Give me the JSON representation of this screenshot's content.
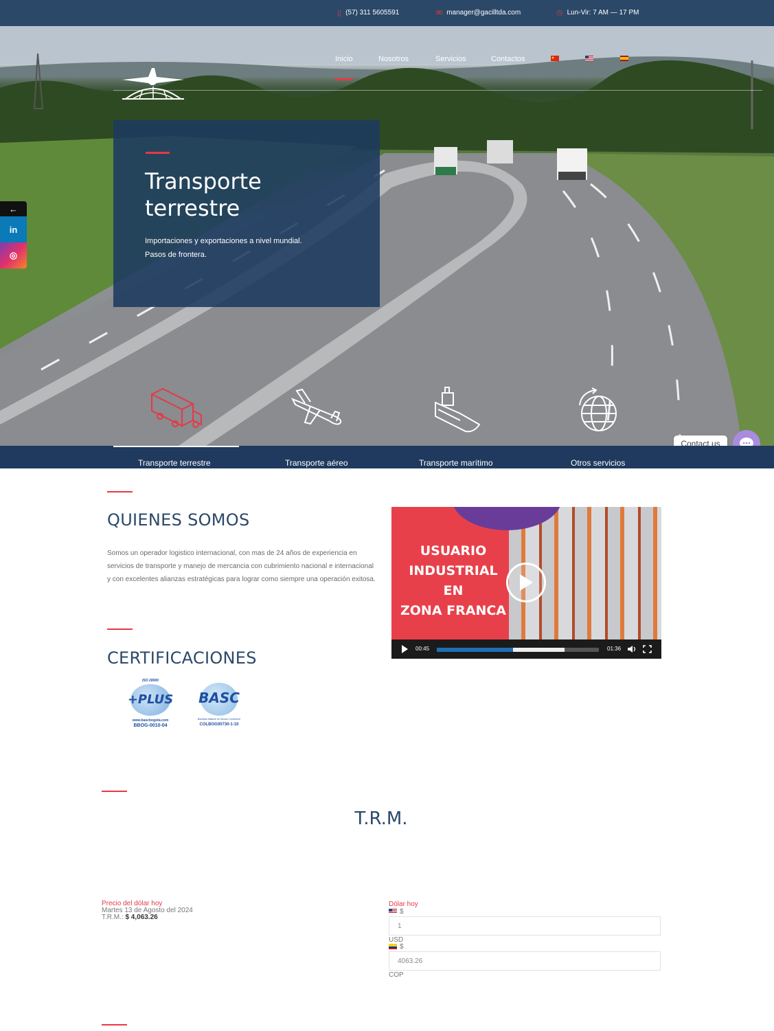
{
  "topbar": {
    "phone": "(57) 311 5605591",
    "email": "manager@gacilltda.com",
    "hours": "Lun-Vir: 7 AM — 17 PM",
    "icons": [
      "phone-icon",
      "mail-icon",
      "clock-icon"
    ]
  },
  "nav": {
    "items": [
      "Inicio",
      "Nosotros",
      "Servicios",
      "Contactos"
    ],
    "active": "Inicio",
    "languages": [
      "chinese-flag",
      "us-flag",
      "spanish-flag"
    ]
  },
  "hero": {
    "title": "Transporte terrestre",
    "line1": "Importaciones y exportaciones a nivel mundial.",
    "line2": "Pasos de frontera."
  },
  "services": {
    "tabs": [
      "Transporte terrestre",
      "Transporte aéreo",
      "Transporte marítimo",
      "Otros servicios"
    ],
    "icons": [
      "truck-icon",
      "airplane-icon",
      "ship-icon",
      "globe-icon"
    ],
    "active": "Transporte terrestre"
  },
  "social": {
    "toggle": "←",
    "linkedin": "in",
    "instagram": "◎"
  },
  "chat": {
    "label": "Contact us"
  },
  "about": {
    "title": "QUIENES SOMOS",
    "text": "Somos un operador logistico internacional, con mas de 24 años de experiencia en servicios de transporte y manejo de mercancia con cubrimiento nacional e internacional y con excelentes alianzas estratégicas para lograr como siempre una operación exitosa."
  },
  "video": {
    "line1": "USUARIO",
    "line2": "INDUSTRIAL",
    "line3": "EN",
    "line4": "ZONA FRANCA",
    "current_time": "00:45",
    "duration": "01:36",
    "progress": 0.47,
    "buffered": 0.79
  },
  "certs": {
    "title": "CERTIFICACIONES",
    "cert1_top": "ISO 28000",
    "cert1_name": "+PLUS",
    "cert1_url": "www.bascbogota.com",
    "cert1_code": "BBOG-0010-04",
    "cert2_name": "BASC",
    "cert2_caption": "Business Alliance for Secure Commerce",
    "cert2_code": "COLBOG00730-1-10"
  },
  "trm": {
    "title": "T.R.M.",
    "price_header": "Precio del dólar hoy",
    "date": "Martes 13 de Agosto del 2024",
    "label": "T.R.M.:",
    "value": "$ 4,063.26",
    "converter_header": "Dólar hoy",
    "usd_symbol": "$",
    "usd_value": "1",
    "usd_code": "USD",
    "cop_symbol": "$",
    "cop_value": "4063.26",
    "cop_code": "COP"
  },
  "colors": {
    "navy": "#2b4868",
    "accent_red": "#e63946",
    "chat_purple": "#a98be0"
  }
}
